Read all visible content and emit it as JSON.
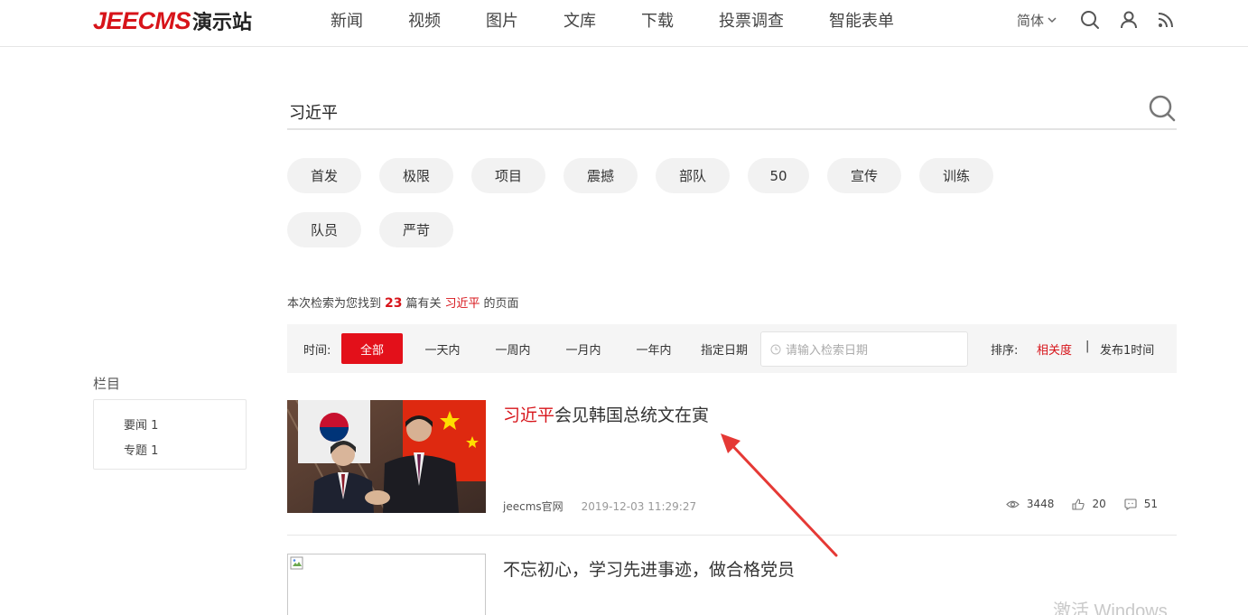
{
  "header": {
    "logo_en": "JEECMS",
    "logo_cn": "演示站",
    "nav": [
      "新闻",
      "视频",
      "图片",
      "文库",
      "下载",
      "投票调查",
      "智能表单"
    ],
    "lang": "简体"
  },
  "search": {
    "value": "习近平"
  },
  "tags": [
    "首发",
    "极限",
    "项目",
    "震撼",
    "部队",
    "50",
    "宣传",
    "训练",
    "队员",
    "严苛"
  ],
  "summary": {
    "prefix": "本次检索为您找到",
    "count": "23",
    "middle": "篇有关",
    "keyword": "习近平",
    "suffix": "的页面"
  },
  "filter": {
    "time_label": "时间:",
    "options": [
      "全部",
      "一天内",
      "一周内",
      "一月内",
      "一年内"
    ],
    "active_index": 0,
    "custom_date_label": "指定日期",
    "date_placeholder": "请输入检索日期",
    "sort_label": "排序:",
    "sort_relevance": "相关度",
    "sort_separator": "|",
    "sort_time": "发布1时间"
  },
  "sidebar": {
    "title": "栏目",
    "items": [
      "要闻 1",
      "专题 1"
    ]
  },
  "articles": [
    {
      "title_highlight": "习近平",
      "title_rest": "会见韩国总统文在寅",
      "source": "jeecms官网",
      "date": "2019-12-03 11:29:27",
      "views": "3448",
      "likes": "20",
      "comments": "51"
    },
    {
      "title_highlight": "",
      "title_rest": "不忘初心，学习先进事迹，做合格党员"
    }
  ],
  "watermark": "激活 Windows",
  "colors": {
    "accent": "#d7141a",
    "active_button": "#e3101a",
    "tag_bg": "#f2f2f2",
    "filter_bg": "#f5f5f5"
  }
}
